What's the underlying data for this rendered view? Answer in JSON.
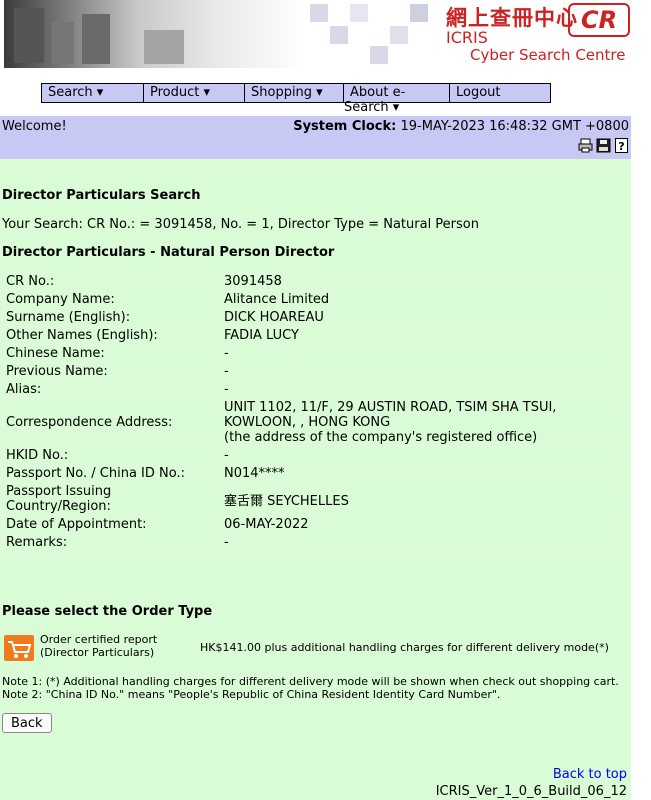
{
  "banner": {
    "logo_chinese": "網上查冊中心",
    "logo_cr": "CR",
    "logo_icris": "ICRIS",
    "logo_cyber": "Cyber Search Centre"
  },
  "menu": {
    "items": [
      {
        "label": "Search ▾"
      },
      {
        "label": "Product ▾"
      },
      {
        "label": "Shopping ▾"
      },
      {
        "label": "About e-"
      },
      {
        "label": "Logout"
      }
    ],
    "about_second_line": "Search ▾"
  },
  "header": {
    "welcome": "Welcome!",
    "clock_label": "System Clock:",
    "clock_value": "19-MAY-2023 16:48:32 GMT +0800"
  },
  "page": {
    "title": "Director Particulars Search",
    "your_search": "Your Search: CR No.: = 3091458, No. = 1, Director Type = Natural Person",
    "section_title": "Director Particulars - Natural Person Director"
  },
  "particulars": [
    {
      "label": "CR No.:",
      "value": [
        "3091458"
      ]
    },
    {
      "label": "Company Name:",
      "value": [
        "Alitance Limited"
      ]
    },
    {
      "label": "Surname (English):",
      "value": [
        "DICK HOAREAU"
      ]
    },
    {
      "label": "Other Names (English):",
      "value": [
        "FADIA LUCY"
      ]
    },
    {
      "label": "Chinese Name:",
      "value": [
        "-"
      ]
    },
    {
      "label": "Previous Name:",
      "value": [
        "-"
      ]
    },
    {
      "label": "Alias:",
      "value": [
        "-"
      ]
    },
    {
      "label": "Correspondence Address:",
      "value": [
        "UNIT 1102, 11/F, 29 AUSTIN ROAD, TSIM SHA TSUI,",
        "KOWLOON, , HONG KONG",
        "(the address of the company's registered office)"
      ]
    },
    {
      "label": "HKID No.:",
      "value": [
        "-"
      ]
    },
    {
      "label": "Passport No. / China ID No.:",
      "value": [
        "N014****"
      ]
    },
    {
      "label": "Passport Issuing Country/Region:",
      "value": [
        "塞舌爾 SEYCHELLES"
      ]
    },
    {
      "label": "Date of Appointment:",
      "value": [
        "06-MAY-2022"
      ]
    },
    {
      "label": "Remarks:",
      "value": [
        "-"
      ]
    }
  ],
  "order": {
    "title": "Please select the Order Type",
    "label_line1": "Order certified report",
    "label_line2": "(Director Particulars)",
    "price": "HK$141.00 plus additional handling charges for different delivery mode(*)"
  },
  "notes": [
    "Note 1: (*) Additional handling charges for different delivery mode will be shown when check out shopping cart.",
    "Note 2: \"China ID No.\" means \"People's Republic of China Resident Identity Card Number\"."
  ],
  "footer": {
    "back_button": "Back",
    "back_to_top": "Back to top",
    "version": "ICRIS_Ver_1_0_6_Build_06_12"
  }
}
